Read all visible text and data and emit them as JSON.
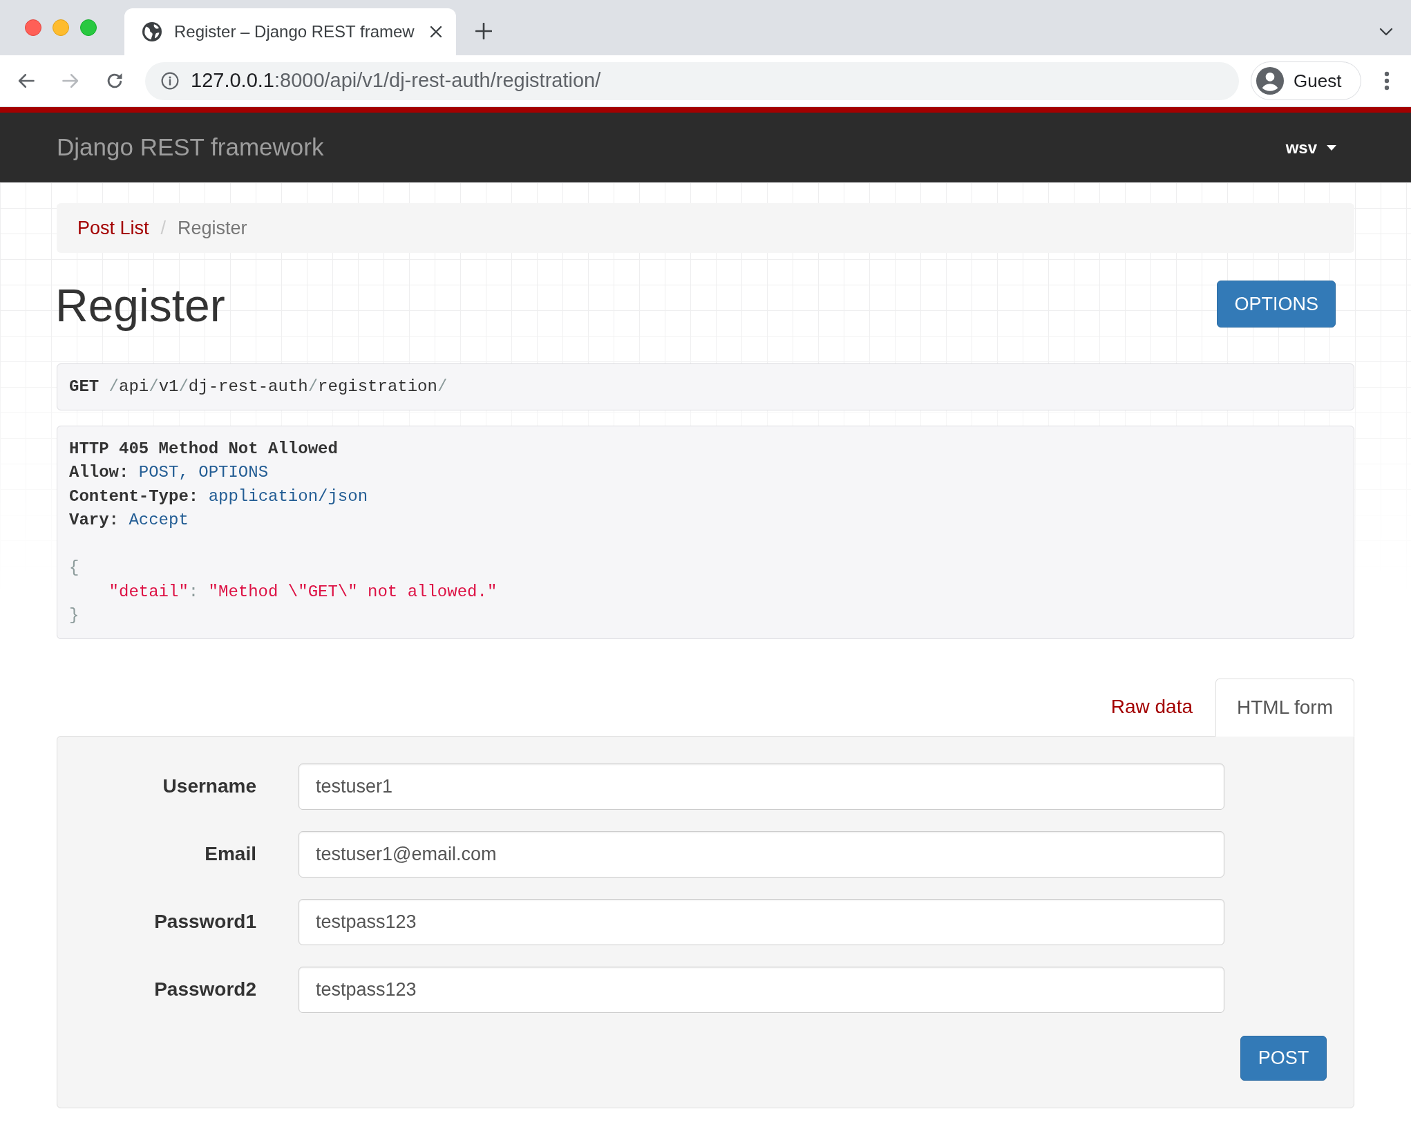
{
  "browser": {
    "tabs": [
      {
        "title": "Register – Django REST framew",
        "selected": true
      }
    ],
    "nav_buttons": [
      {
        "kind": "back",
        "disabled": false
      },
      {
        "kind": "forward",
        "disabled": true
      },
      {
        "kind": "reload",
        "disabled": false
      }
    ],
    "address": {
      "host": "127.0.0.1",
      "rest": ":8000/api/v1/dj-rest-auth/registration/"
    },
    "profile": "Guest"
  },
  "navbar": {
    "brand": "Django REST framework",
    "user": "wsv"
  },
  "breadcrumb": {
    "separator": "/",
    "items": [
      {
        "label": "Post List",
        "selected": false
      },
      {
        "label": "Register",
        "selected": true
      }
    ]
  },
  "page_title": "Register",
  "options_button": "OPTIONS",
  "request": {
    "method": "GET",
    "path": "/api/v1/dj-rest-auth/registration/"
  },
  "response": {
    "status": "HTTP 405 Method Not Allowed",
    "headers": [
      {
        "name": "Allow:",
        "value": "POST, OPTIONS"
      },
      {
        "name": "Content-Type:",
        "value": "application/json"
      },
      {
        "name": "Vary:",
        "value": "Accept"
      }
    ],
    "body": {
      "open": "{",
      "entries": [
        {
          "key": "\"detail\"",
          "separator": ":",
          "value": "\"Method \\\"GET\\\" not allowed.\""
        }
      ],
      "close": "}"
    }
  },
  "content_tabs": [
    {
      "label": "Raw data",
      "selected": false
    },
    {
      "label": "HTML form",
      "selected": true
    }
  ],
  "form": {
    "fields": [
      {
        "label": "Username",
        "value": "testuser1"
      },
      {
        "label": "Email",
        "value": "testuser1@email.com"
      },
      {
        "label": "Password1",
        "value": "testpass123"
      },
      {
        "label": "Password2",
        "value": "testpass123"
      }
    ],
    "submit": "POST"
  }
}
